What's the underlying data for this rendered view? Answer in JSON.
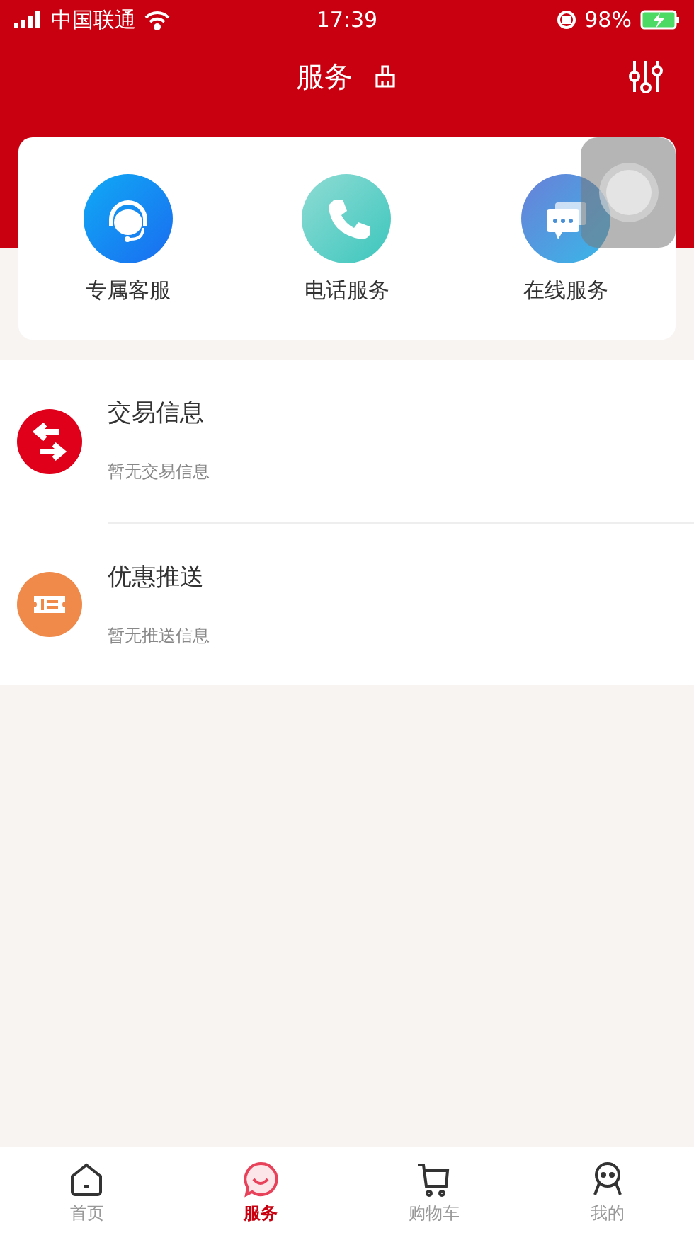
{
  "status_bar": {
    "carrier": "中国联通",
    "time": "17:39",
    "battery": "98%"
  },
  "header": {
    "title": "服务"
  },
  "services": [
    {
      "kind": "agent",
      "label": "专属客服"
    },
    {
      "kind": "phone",
      "label": "电话服务"
    },
    {
      "kind": "chat",
      "label": "在线服务"
    }
  ],
  "messages": [
    {
      "kind": "trade",
      "title": "交易信息",
      "subtitle": "暂无交易信息"
    },
    {
      "kind": "coupon",
      "title": "优惠推送",
      "subtitle": "暂无推送信息"
    }
  ],
  "tabs": [
    {
      "kind": "home",
      "label": "首页",
      "selected": false
    },
    {
      "kind": "service",
      "label": "服务",
      "selected": true
    },
    {
      "kind": "cart",
      "label": "购物车",
      "selected": false
    },
    {
      "kind": "me",
      "label": "我的",
      "selected": false
    }
  ]
}
